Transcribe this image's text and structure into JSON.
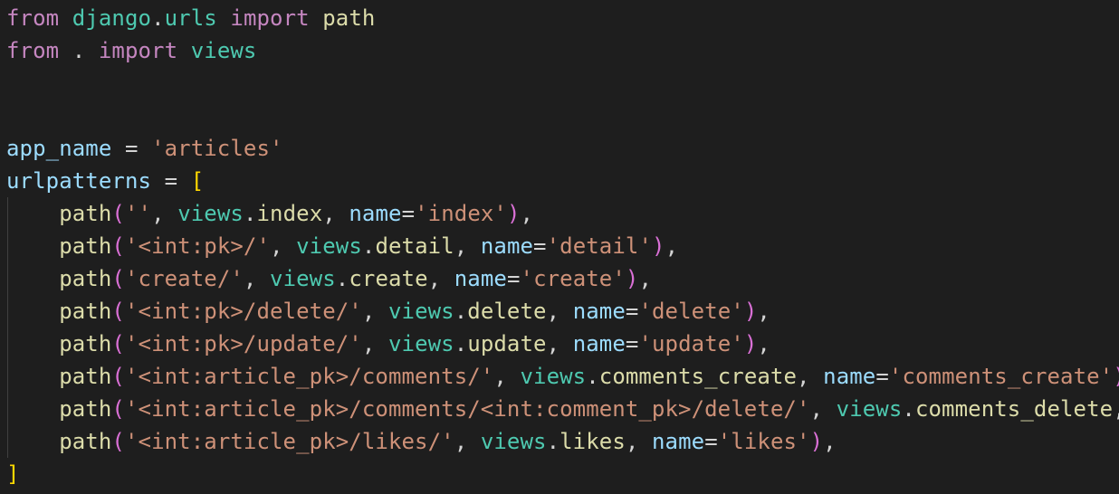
{
  "colors": {
    "background": "#1e1e1e",
    "keyword": "#c586c0",
    "module": "#4ec9b0",
    "function": "#dcdcaa",
    "variable": "#9cdcfe",
    "string": "#ce9178",
    "operator": "#d4d4d4",
    "bracket_outer": "#ffd700",
    "bracket_inner": "#da70d6"
  },
  "code": {
    "lines": [
      [
        {
          "t": "from",
          "c": "kw"
        },
        {
          "t": " ",
          "c": "plain"
        },
        {
          "t": "django",
          "c": "mod"
        },
        {
          "t": ".",
          "c": "plain"
        },
        {
          "t": "urls",
          "c": "mod"
        },
        {
          "t": " ",
          "c": "plain"
        },
        {
          "t": "import",
          "c": "kw"
        },
        {
          "t": " ",
          "c": "plain"
        },
        {
          "t": "path",
          "c": "fn"
        }
      ],
      [
        {
          "t": "from",
          "c": "kw"
        },
        {
          "t": " . ",
          "c": "plain"
        },
        {
          "t": "import",
          "c": "kw"
        },
        {
          "t": " ",
          "c": "plain"
        },
        {
          "t": "views",
          "c": "mod"
        }
      ],
      [],
      [],
      [
        {
          "t": "app_name",
          "c": "var"
        },
        {
          "t": " = ",
          "c": "op"
        },
        {
          "t": "'articles'",
          "c": "str"
        }
      ],
      [
        {
          "t": "urlpatterns",
          "c": "var"
        },
        {
          "t": " = ",
          "c": "op"
        },
        {
          "t": "[",
          "c": "br1"
        }
      ],
      [
        {
          "t": "    ",
          "c": "plain"
        },
        {
          "t": "path",
          "c": "fn"
        },
        {
          "t": "(",
          "c": "br2"
        },
        {
          "t": "''",
          "c": "str"
        },
        {
          "t": ", ",
          "c": "plain"
        },
        {
          "t": "views",
          "c": "mod"
        },
        {
          "t": ".",
          "c": "plain"
        },
        {
          "t": "index",
          "c": "fn"
        },
        {
          "t": ", ",
          "c": "plain"
        },
        {
          "t": "name",
          "c": "var"
        },
        {
          "t": "=",
          "c": "op"
        },
        {
          "t": "'index'",
          "c": "str"
        },
        {
          "t": ")",
          "c": "br2"
        },
        {
          "t": ",",
          "c": "plain"
        }
      ],
      [
        {
          "t": "    ",
          "c": "plain"
        },
        {
          "t": "path",
          "c": "fn"
        },
        {
          "t": "(",
          "c": "br2"
        },
        {
          "t": "'<int:pk>/'",
          "c": "str"
        },
        {
          "t": ", ",
          "c": "plain"
        },
        {
          "t": "views",
          "c": "mod"
        },
        {
          "t": ".",
          "c": "plain"
        },
        {
          "t": "detail",
          "c": "fn"
        },
        {
          "t": ", ",
          "c": "plain"
        },
        {
          "t": "name",
          "c": "var"
        },
        {
          "t": "=",
          "c": "op"
        },
        {
          "t": "'detail'",
          "c": "str"
        },
        {
          "t": ")",
          "c": "br2"
        },
        {
          "t": ",",
          "c": "plain"
        }
      ],
      [
        {
          "t": "    ",
          "c": "plain"
        },
        {
          "t": "path",
          "c": "fn"
        },
        {
          "t": "(",
          "c": "br2"
        },
        {
          "t": "'create/'",
          "c": "str"
        },
        {
          "t": ", ",
          "c": "plain"
        },
        {
          "t": "views",
          "c": "mod"
        },
        {
          "t": ".",
          "c": "plain"
        },
        {
          "t": "create",
          "c": "fn"
        },
        {
          "t": ", ",
          "c": "plain"
        },
        {
          "t": "name",
          "c": "var"
        },
        {
          "t": "=",
          "c": "op"
        },
        {
          "t": "'create'",
          "c": "str"
        },
        {
          "t": ")",
          "c": "br2"
        },
        {
          "t": ",",
          "c": "plain"
        }
      ],
      [
        {
          "t": "    ",
          "c": "plain"
        },
        {
          "t": "path",
          "c": "fn"
        },
        {
          "t": "(",
          "c": "br2"
        },
        {
          "t": "'<int:pk>/delete/'",
          "c": "str"
        },
        {
          "t": ", ",
          "c": "plain"
        },
        {
          "t": "views",
          "c": "mod"
        },
        {
          "t": ".",
          "c": "plain"
        },
        {
          "t": "delete",
          "c": "fn"
        },
        {
          "t": ", ",
          "c": "plain"
        },
        {
          "t": "name",
          "c": "var"
        },
        {
          "t": "=",
          "c": "op"
        },
        {
          "t": "'delete'",
          "c": "str"
        },
        {
          "t": ")",
          "c": "br2"
        },
        {
          "t": ",",
          "c": "plain"
        }
      ],
      [
        {
          "t": "    ",
          "c": "plain"
        },
        {
          "t": "path",
          "c": "fn"
        },
        {
          "t": "(",
          "c": "br2"
        },
        {
          "t": "'<int:pk>/update/'",
          "c": "str"
        },
        {
          "t": ", ",
          "c": "plain"
        },
        {
          "t": "views",
          "c": "mod"
        },
        {
          "t": ".",
          "c": "plain"
        },
        {
          "t": "update",
          "c": "fn"
        },
        {
          "t": ", ",
          "c": "plain"
        },
        {
          "t": "name",
          "c": "var"
        },
        {
          "t": "=",
          "c": "op"
        },
        {
          "t": "'update'",
          "c": "str"
        },
        {
          "t": ")",
          "c": "br2"
        },
        {
          "t": ",",
          "c": "plain"
        }
      ],
      [
        {
          "t": "    ",
          "c": "plain"
        },
        {
          "t": "path",
          "c": "fn"
        },
        {
          "t": "(",
          "c": "br2"
        },
        {
          "t": "'<int:article_pk>/comments/'",
          "c": "str"
        },
        {
          "t": ", ",
          "c": "plain"
        },
        {
          "t": "views",
          "c": "mod"
        },
        {
          "t": ".",
          "c": "plain"
        },
        {
          "t": "comments_create",
          "c": "fn"
        },
        {
          "t": ", ",
          "c": "plain"
        },
        {
          "t": "name",
          "c": "var"
        },
        {
          "t": "=",
          "c": "op"
        },
        {
          "t": "'comments_create'",
          "c": "str"
        },
        {
          "t": ")",
          "c": "br2"
        }
      ],
      [
        {
          "t": "    ",
          "c": "plain"
        },
        {
          "t": "path",
          "c": "fn"
        },
        {
          "t": "(",
          "c": "br2"
        },
        {
          "t": "'<int:article_pk>/comments/<int:comment_pk>/delete/'",
          "c": "str"
        },
        {
          "t": ", ",
          "c": "plain"
        },
        {
          "t": "views",
          "c": "mod"
        },
        {
          "t": ".",
          "c": "plain"
        },
        {
          "t": "comments_delete",
          "c": "fn"
        },
        {
          "t": ",",
          "c": "plain"
        }
      ],
      [
        {
          "t": "    ",
          "c": "plain"
        },
        {
          "t": "path",
          "c": "fn"
        },
        {
          "t": "(",
          "c": "br2"
        },
        {
          "t": "'<int:article_pk>/likes/'",
          "c": "str"
        },
        {
          "t": ", ",
          "c": "plain"
        },
        {
          "t": "views",
          "c": "mod"
        },
        {
          "t": ".",
          "c": "plain"
        },
        {
          "t": "likes",
          "c": "fn"
        },
        {
          "t": ", ",
          "c": "plain"
        },
        {
          "t": "name",
          "c": "var"
        },
        {
          "t": "=",
          "c": "op"
        },
        {
          "t": "'likes'",
          "c": "str"
        },
        {
          "t": ")",
          "c": "br2"
        },
        {
          "t": ",",
          "c": "plain"
        }
      ],
      [
        {
          "t": "]",
          "c": "br1"
        }
      ]
    ]
  }
}
